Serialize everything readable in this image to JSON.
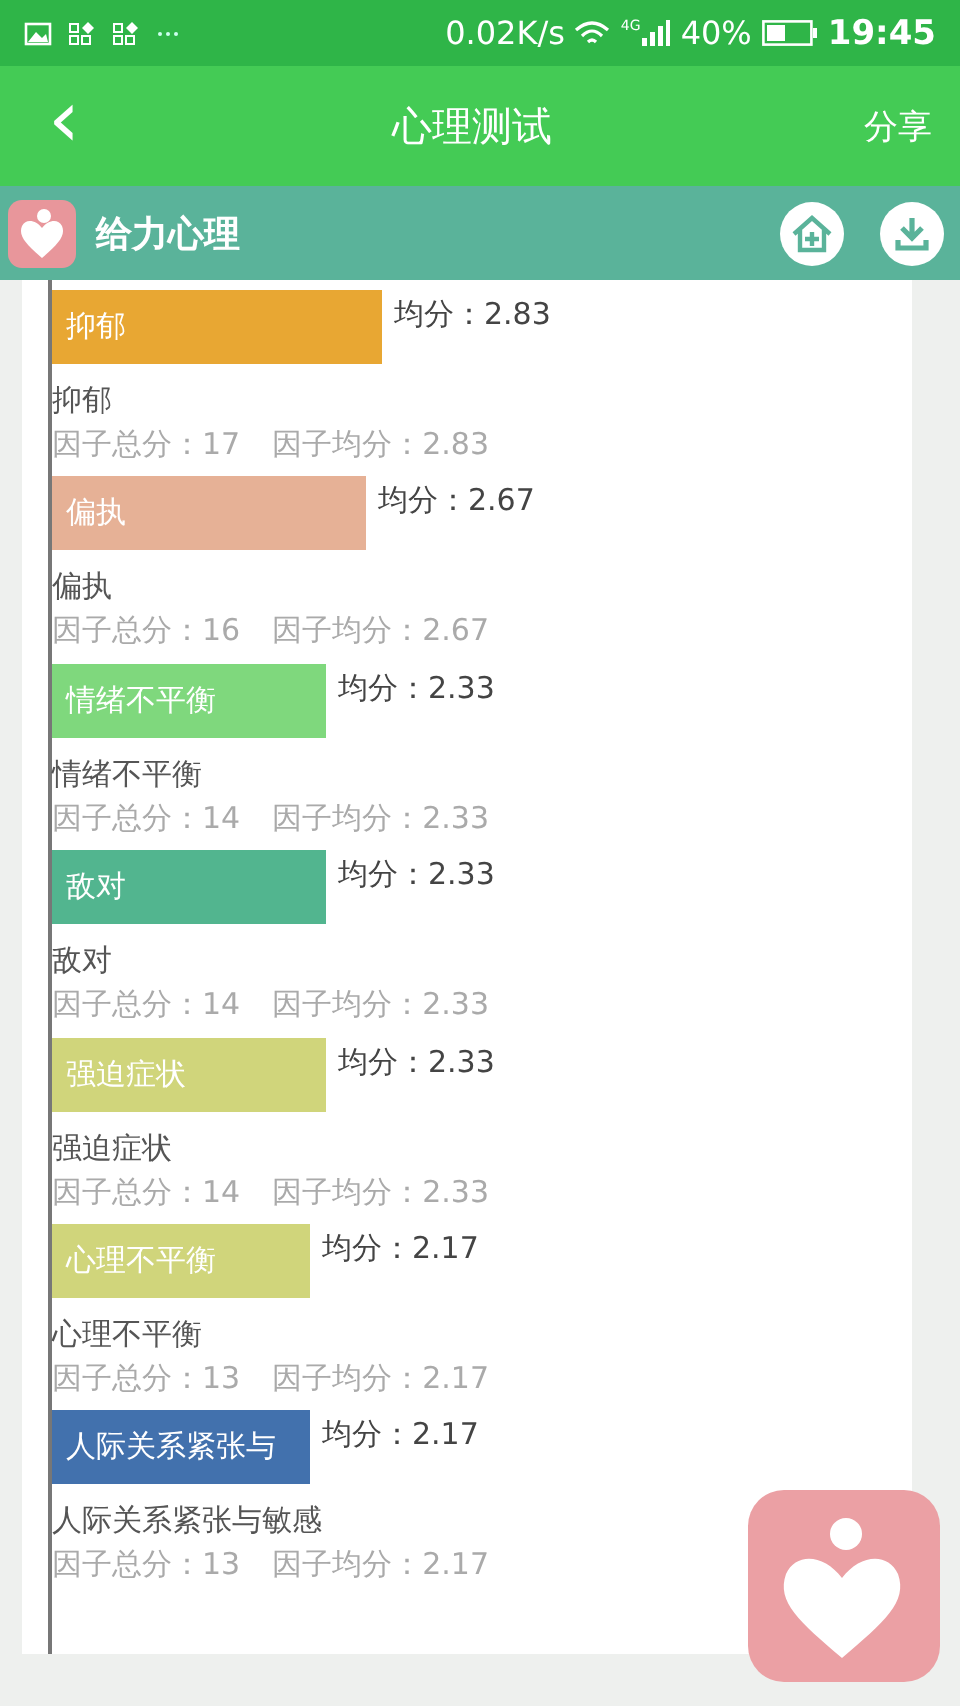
{
  "status_bar": {
    "speed": "0.02K/s",
    "network": "4G",
    "battery": "40%",
    "time": "19:45"
  },
  "app_bar": {
    "back": "‹",
    "title": "心理测试",
    "action": "分享"
  },
  "brand_bar": {
    "name": "给力心理"
  },
  "factors": [
    {
      "bar_label": "抑郁",
      "color": "#e8a733",
      "mean": "均分：2.83",
      "name": "抑郁",
      "total": "因子总分：17",
      "average": "因子均分：2.83"
    },
    {
      "bar_label": "偏执",
      "color": "#e6b196",
      "mean": "均分：2.67",
      "name": "偏执",
      "total": "因子总分：16",
      "average": "因子均分：2.67"
    },
    {
      "bar_label": "情绪不平衡",
      "color": "#7fd87d",
      "mean": "均分：2.33",
      "name": "情绪不平衡",
      "total": "因子总分：14",
      "average": "因子均分：2.33"
    },
    {
      "bar_label": "敌对",
      "color": "#52b58f",
      "mean": "均分：2.33",
      "name": "敌对",
      "total": "因子总分：14",
      "average": "因子均分：2.33"
    },
    {
      "bar_label": "强迫症状",
      "color": "#d0d57b",
      "mean": "均分：2.33",
      "name": "强迫症状",
      "total": "因子总分：14",
      "average": "因子均分：2.33"
    },
    {
      "bar_label": "心理不平衡",
      "color": "#d0d57b",
      "mean": "均分：2.17",
      "name": "心理不平衡",
      "total": "因子总分：13",
      "average": "因子均分：2.17"
    },
    {
      "bar_label": "人际关系紧张与",
      "color": "#4271ad",
      "mean": "均分：2.17",
      "name": "人际关系紧张与敏感",
      "total": "因子总分：13",
      "average": "因子均分：2.17"
    }
  ]
}
